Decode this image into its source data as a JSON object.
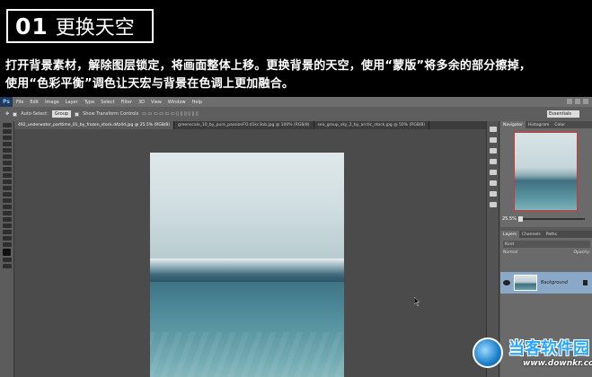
{
  "header": {
    "step_number": "01",
    "step_title": "更换天空",
    "description_line1": "打开背景素材，解除图层锁定，将画面整体上移。更换背景的天空，使用“蒙版”将多余的部分擦掉，",
    "description_line2": "使用“色彩平衡”调色让天宏与背景在色调上更加融合。"
  },
  "photoshop": {
    "logo": "Ps",
    "menu": [
      "File",
      "Edit",
      "Image",
      "Layer",
      "Type",
      "Select",
      "Filter",
      "3D",
      "View",
      "Window",
      "Help"
    ],
    "options": {
      "auto_select_label": "Auto-Select:",
      "auto_select_value": "Group",
      "show_transform_label": "Show Transform Controls",
      "workspace": "Essentials"
    },
    "tabs": [
      "492_underwater_parttime_01_by_frozen_stock.d4z4d.jpg @ 25.5% (RGB/8)",
      "greenscale_10_by_pure_passionFO.d1kc3ob.jpg @ 100% (RGB/8)",
      "sea_group_sky_2_by_arctic_stock.jpg @ 50% (RGB/8)"
    ],
    "panels": {
      "navigator_tabs": [
        "Navigator",
        "Histogram",
        "Color"
      ],
      "zoom": "25.5%",
      "layers_tabs": [
        "Layers",
        "Channels",
        "Paths"
      ],
      "filter_label": "Kind",
      "blend_mode": "Normal",
      "opacity_label": "Opacity:",
      "layer_name": "Background"
    }
  },
  "watermark": {
    "name": "当客软件园",
    "url": "www.downkr.com"
  }
}
